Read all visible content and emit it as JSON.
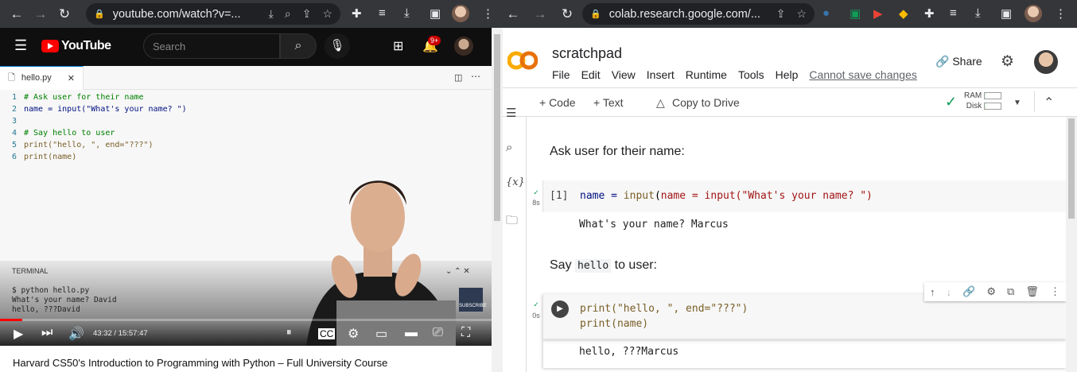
{
  "left_browser": {
    "url": "youtube.com/watch?v=...",
    "youtube": {
      "logo_text": "YouTube",
      "search_placeholder": "Search",
      "notification_count": "9+",
      "video": {
        "editor_tab": "hello.py",
        "code_lines": [
          {
            "n": "1",
            "text": "# Ask user for their name"
          },
          {
            "n": "2",
            "text": "name = input(\"What's your name? \")"
          },
          {
            "n": "3",
            "text": ""
          },
          {
            "n": "4",
            "text": "# Say hello to user"
          },
          {
            "n": "5",
            "text": "print(\"hello, \", end=\"???\")"
          },
          {
            "n": "6",
            "text": "print(name)"
          }
        ],
        "terminal_label": "TERMINAL",
        "terminal_lines": [
          "$ python hello.py",
          "What's your name? David",
          "hello, ???David"
        ],
        "subscribe_label": "SUBSCRIBE",
        "time": "43:32 / 15:57:47",
        "progress": 0.046
      },
      "title": "Harvard CS50's Introduction to Programming with Python – Full University Course"
    }
  },
  "right_browser": {
    "url": "colab.research.google.com/...",
    "colab": {
      "logo": "CO",
      "notebook_title": "scratchpad",
      "menu": [
        "File",
        "Edit",
        "View",
        "Insert",
        "Runtime",
        "Tools",
        "Help"
      ],
      "save_status": "Cannot save changes",
      "share_label": "Share",
      "toolbar": {
        "code": "+ Code",
        "text": "+ Text",
        "copy_drive": "Copy to Drive"
      },
      "resources": {
        "ram": "RAM",
        "disk": "Disk"
      },
      "cells": {
        "md1": "Ask user for their name:",
        "code1_prompt": "[1]",
        "code1_time": "8s",
        "code1_source": "name = input(\"What's your name? \")",
        "code1_output": "What's your name? Marcus",
        "md2_before": "Say",
        "md2_code": "hello",
        "md2_after": "to user:",
        "code2_time": "0s",
        "code2_line1": "print(\"hello, \", end=\"???\")",
        "code2_line2": "print(name)",
        "code2_output": "hello, ???Marcus"
      }
    }
  }
}
